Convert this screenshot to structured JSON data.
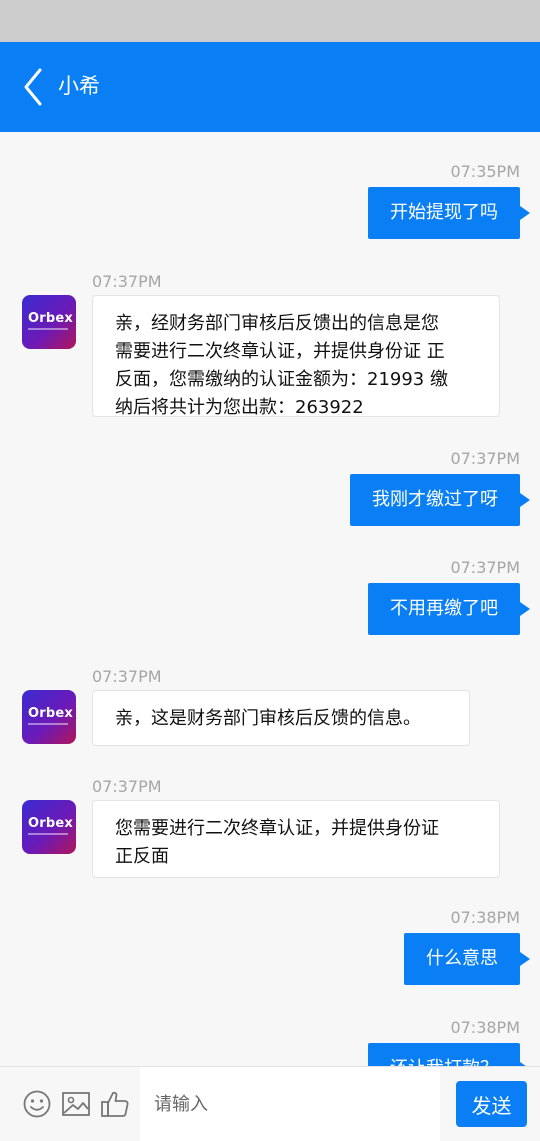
{
  "header": {
    "title": "小希"
  },
  "colors": {
    "accent": "#0a7ff5",
    "status_bar": "#cccccc",
    "background": "#f7f7f7"
  },
  "contact_avatar": {
    "logo_text": "Orbex"
  },
  "messages": [
    {
      "direction": "out",
      "time": "07:35PM",
      "text": "开始提现了吗"
    },
    {
      "direction": "in",
      "time": "07:37PM",
      "lines": [
        "亲，经财务部门审核后反馈出的信息是您",
        "需要进行二次终章认证，并提供身份证 正",
        "反面，您需缴纳的认证金额为：21993 缴",
        "纳后将共计为您出款：263922"
      ]
    },
    {
      "direction": "out",
      "time": "07:37PM",
      "text": "我刚才缴过了呀"
    },
    {
      "direction": "out",
      "time": "07:37PM",
      "text": "不用再缴了吧"
    },
    {
      "direction": "in",
      "time": "07:37PM",
      "lines": [
        "亲，这是财务部门审核后反馈的信息。"
      ]
    },
    {
      "direction": "in",
      "time": "07:37PM",
      "lines": [
        "您需要进行二次终章认证，并提供身份证",
        "正反面"
      ]
    },
    {
      "direction": "out",
      "time": "07:38PM",
      "text": "什么意思"
    },
    {
      "direction": "out",
      "time": "07:38PM",
      "text": "还让我打款？"
    }
  ],
  "input_bar": {
    "icons": [
      "emoji-icon",
      "image-icon",
      "thumbs-up-icon"
    ],
    "placeholder": "请输入",
    "send_label": "发送"
  }
}
